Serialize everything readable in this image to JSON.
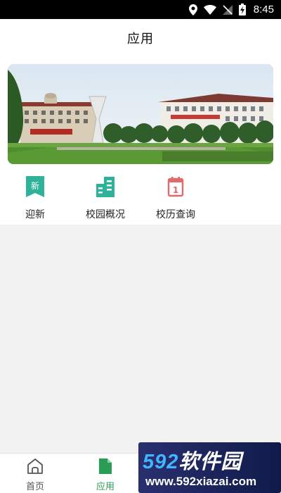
{
  "status_bar": {
    "time": "8:45"
  },
  "header": {
    "title": "应用"
  },
  "apps": [
    {
      "label": "迎新",
      "icon_text": "新",
      "icon": "new-student-icon",
      "color": "#2fb29a"
    },
    {
      "label": "校园概况",
      "icon": "buildings-icon",
      "color": "#2fb29a"
    },
    {
      "label": "校历查询",
      "icon_text": "1",
      "icon": "calendar-icon",
      "color": "#e26a6a"
    }
  ],
  "nav": {
    "items": [
      {
        "label": "首页",
        "icon": "home-icon",
        "active": false
      },
      {
        "label": "应用",
        "icon": "document-icon",
        "active": true
      }
    ],
    "active_color": "#2a9d55"
  },
  "watermark": {
    "brand_num": "592",
    "brand_text": "软件园",
    "url": "www.592xiazai.com"
  }
}
